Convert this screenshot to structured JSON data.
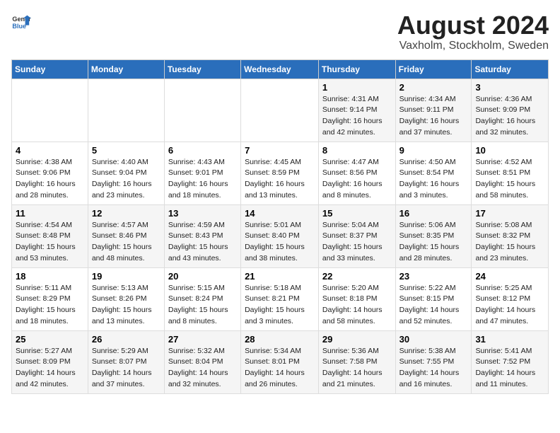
{
  "logo": {
    "general": "General",
    "blue": "Blue"
  },
  "title": "August 2024",
  "subtitle": "Vaxholm, Stockholm, Sweden",
  "days_of_week": [
    "Sunday",
    "Monday",
    "Tuesday",
    "Wednesday",
    "Thursday",
    "Friday",
    "Saturday"
  ],
  "weeks": [
    [
      {
        "day": "",
        "info": ""
      },
      {
        "day": "",
        "info": ""
      },
      {
        "day": "",
        "info": ""
      },
      {
        "day": "",
        "info": ""
      },
      {
        "day": "1",
        "info": "Sunrise: 4:31 AM\nSunset: 9:14 PM\nDaylight: 16 hours and 42 minutes."
      },
      {
        "day": "2",
        "info": "Sunrise: 4:34 AM\nSunset: 9:11 PM\nDaylight: 16 hours and 37 minutes."
      },
      {
        "day": "3",
        "info": "Sunrise: 4:36 AM\nSunset: 9:09 PM\nDaylight: 16 hours and 32 minutes."
      }
    ],
    [
      {
        "day": "4",
        "info": "Sunrise: 4:38 AM\nSunset: 9:06 PM\nDaylight: 16 hours and 28 minutes."
      },
      {
        "day": "5",
        "info": "Sunrise: 4:40 AM\nSunset: 9:04 PM\nDaylight: 16 hours and 23 minutes."
      },
      {
        "day": "6",
        "info": "Sunrise: 4:43 AM\nSunset: 9:01 PM\nDaylight: 16 hours and 18 minutes."
      },
      {
        "day": "7",
        "info": "Sunrise: 4:45 AM\nSunset: 8:59 PM\nDaylight: 16 hours and 13 minutes."
      },
      {
        "day": "8",
        "info": "Sunrise: 4:47 AM\nSunset: 8:56 PM\nDaylight: 16 hours and 8 minutes."
      },
      {
        "day": "9",
        "info": "Sunrise: 4:50 AM\nSunset: 8:54 PM\nDaylight: 16 hours and 3 minutes."
      },
      {
        "day": "10",
        "info": "Sunrise: 4:52 AM\nSunset: 8:51 PM\nDaylight: 15 hours and 58 minutes."
      }
    ],
    [
      {
        "day": "11",
        "info": "Sunrise: 4:54 AM\nSunset: 8:48 PM\nDaylight: 15 hours and 53 minutes."
      },
      {
        "day": "12",
        "info": "Sunrise: 4:57 AM\nSunset: 8:46 PM\nDaylight: 15 hours and 48 minutes."
      },
      {
        "day": "13",
        "info": "Sunrise: 4:59 AM\nSunset: 8:43 PM\nDaylight: 15 hours and 43 minutes."
      },
      {
        "day": "14",
        "info": "Sunrise: 5:01 AM\nSunset: 8:40 PM\nDaylight: 15 hours and 38 minutes."
      },
      {
        "day": "15",
        "info": "Sunrise: 5:04 AM\nSunset: 8:37 PM\nDaylight: 15 hours and 33 minutes."
      },
      {
        "day": "16",
        "info": "Sunrise: 5:06 AM\nSunset: 8:35 PM\nDaylight: 15 hours and 28 minutes."
      },
      {
        "day": "17",
        "info": "Sunrise: 5:08 AM\nSunset: 8:32 PM\nDaylight: 15 hours and 23 minutes."
      }
    ],
    [
      {
        "day": "18",
        "info": "Sunrise: 5:11 AM\nSunset: 8:29 PM\nDaylight: 15 hours and 18 minutes."
      },
      {
        "day": "19",
        "info": "Sunrise: 5:13 AM\nSunset: 8:26 PM\nDaylight: 15 hours and 13 minutes."
      },
      {
        "day": "20",
        "info": "Sunrise: 5:15 AM\nSunset: 8:24 PM\nDaylight: 15 hours and 8 minutes."
      },
      {
        "day": "21",
        "info": "Sunrise: 5:18 AM\nSunset: 8:21 PM\nDaylight: 15 hours and 3 minutes."
      },
      {
        "day": "22",
        "info": "Sunrise: 5:20 AM\nSunset: 8:18 PM\nDaylight: 14 hours and 58 minutes."
      },
      {
        "day": "23",
        "info": "Sunrise: 5:22 AM\nSunset: 8:15 PM\nDaylight: 14 hours and 52 minutes."
      },
      {
        "day": "24",
        "info": "Sunrise: 5:25 AM\nSunset: 8:12 PM\nDaylight: 14 hours and 47 minutes."
      }
    ],
    [
      {
        "day": "25",
        "info": "Sunrise: 5:27 AM\nSunset: 8:09 PM\nDaylight: 14 hours and 42 minutes."
      },
      {
        "day": "26",
        "info": "Sunrise: 5:29 AM\nSunset: 8:07 PM\nDaylight: 14 hours and 37 minutes."
      },
      {
        "day": "27",
        "info": "Sunrise: 5:32 AM\nSunset: 8:04 PM\nDaylight: 14 hours and 32 minutes."
      },
      {
        "day": "28",
        "info": "Sunrise: 5:34 AM\nSunset: 8:01 PM\nDaylight: 14 hours and 26 minutes."
      },
      {
        "day": "29",
        "info": "Sunrise: 5:36 AM\nSunset: 7:58 PM\nDaylight: 14 hours and 21 minutes."
      },
      {
        "day": "30",
        "info": "Sunrise: 5:38 AM\nSunset: 7:55 PM\nDaylight: 14 hours and 16 minutes."
      },
      {
        "day": "31",
        "info": "Sunrise: 5:41 AM\nSunset: 7:52 PM\nDaylight: 14 hours and 11 minutes."
      }
    ]
  ]
}
